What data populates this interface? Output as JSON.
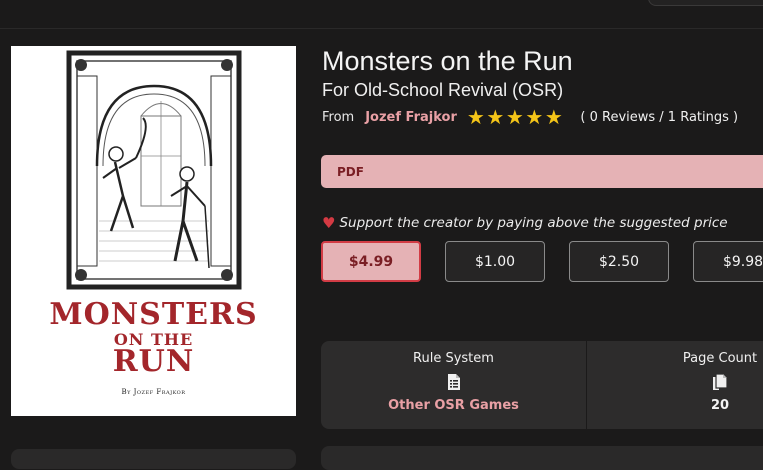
{
  "product": {
    "title": "Monsters on the Run",
    "subtitle": "For Old-School Revival (OSR)",
    "from_label": "From",
    "author": "Jozef Frajkor",
    "rating_stars": 5,
    "ratings_text": "( 0 Reviews / 1 Ratings )"
  },
  "cover": {
    "title_line1": "MONSTERS",
    "title_line2": "ON THE",
    "title_line3": "RUN",
    "byline": "By Jozef Frajkor"
  },
  "format": {
    "label": "PDF"
  },
  "support": {
    "text": "Support the creator by paying above the suggested price"
  },
  "prices": [
    "$4.99",
    "$1.00",
    "$2.50",
    "$9.98"
  ],
  "selected_price_index": 0,
  "info": {
    "rule_system": {
      "label": "Rule System",
      "value": "Other OSR Games",
      "icon": "list-document-icon"
    },
    "page_count": {
      "label": "Page Count",
      "value": "20",
      "icon": "copy-pages-icon"
    }
  },
  "colors": {
    "background": "#1b1a1a",
    "accent_pink": "#e5b2b5",
    "accent_red": "#d23c45",
    "link_pink": "#e9a0a5",
    "star_gold": "#f5c518",
    "cover_red": "#a3262b"
  }
}
